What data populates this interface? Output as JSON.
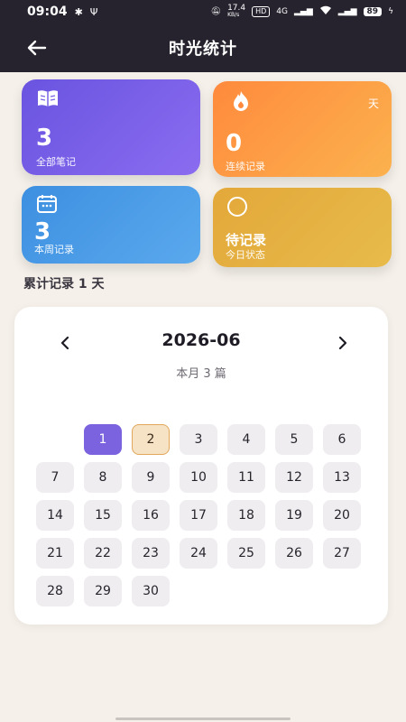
{
  "status_bar": {
    "time": "09:04",
    "speed": "17.4",
    "speed_unit": "KB/s",
    "hd": "HD",
    "network": "4G",
    "battery": "89"
  },
  "header": {
    "title": "时光统计",
    "back_icon": "arrow-left-icon"
  },
  "cards": {
    "notes": {
      "value": "3",
      "label": "全部笔记",
      "icon": "book-icon",
      "color": "#6a54e0"
    },
    "streak": {
      "value": "0",
      "label": "连续记录",
      "corner": "天",
      "icon": "flame-icon",
      "color": "#ff8a3d"
    },
    "week": {
      "value": "3",
      "label": "本周记录",
      "icon": "calendar-icon",
      "color": "#3d8fe0"
    },
    "pending": {
      "value": "待记录",
      "label": "今日状态",
      "icon": "circle-icon",
      "color": "#e3a83a"
    }
  },
  "section": {
    "title": "累计记录 1 天"
  },
  "calendar": {
    "month": "2026-06",
    "count": "本月 3 篇",
    "prev_icon": "chevron-left-icon",
    "next_icon": "chevron-right-icon",
    "selected_day": "1",
    "today_day": "2",
    "days": [
      "1",
      "2",
      "3",
      "4",
      "5",
      "6",
      "7",
      "8",
      "9",
      "10",
      "11",
      "12",
      "13",
      "14",
      "15",
      "16",
      "17",
      "18",
      "19",
      "20",
      "21",
      "22",
      "23",
      "24",
      "25",
      "26",
      "27",
      "28",
      "29",
      "30"
    ]
  }
}
